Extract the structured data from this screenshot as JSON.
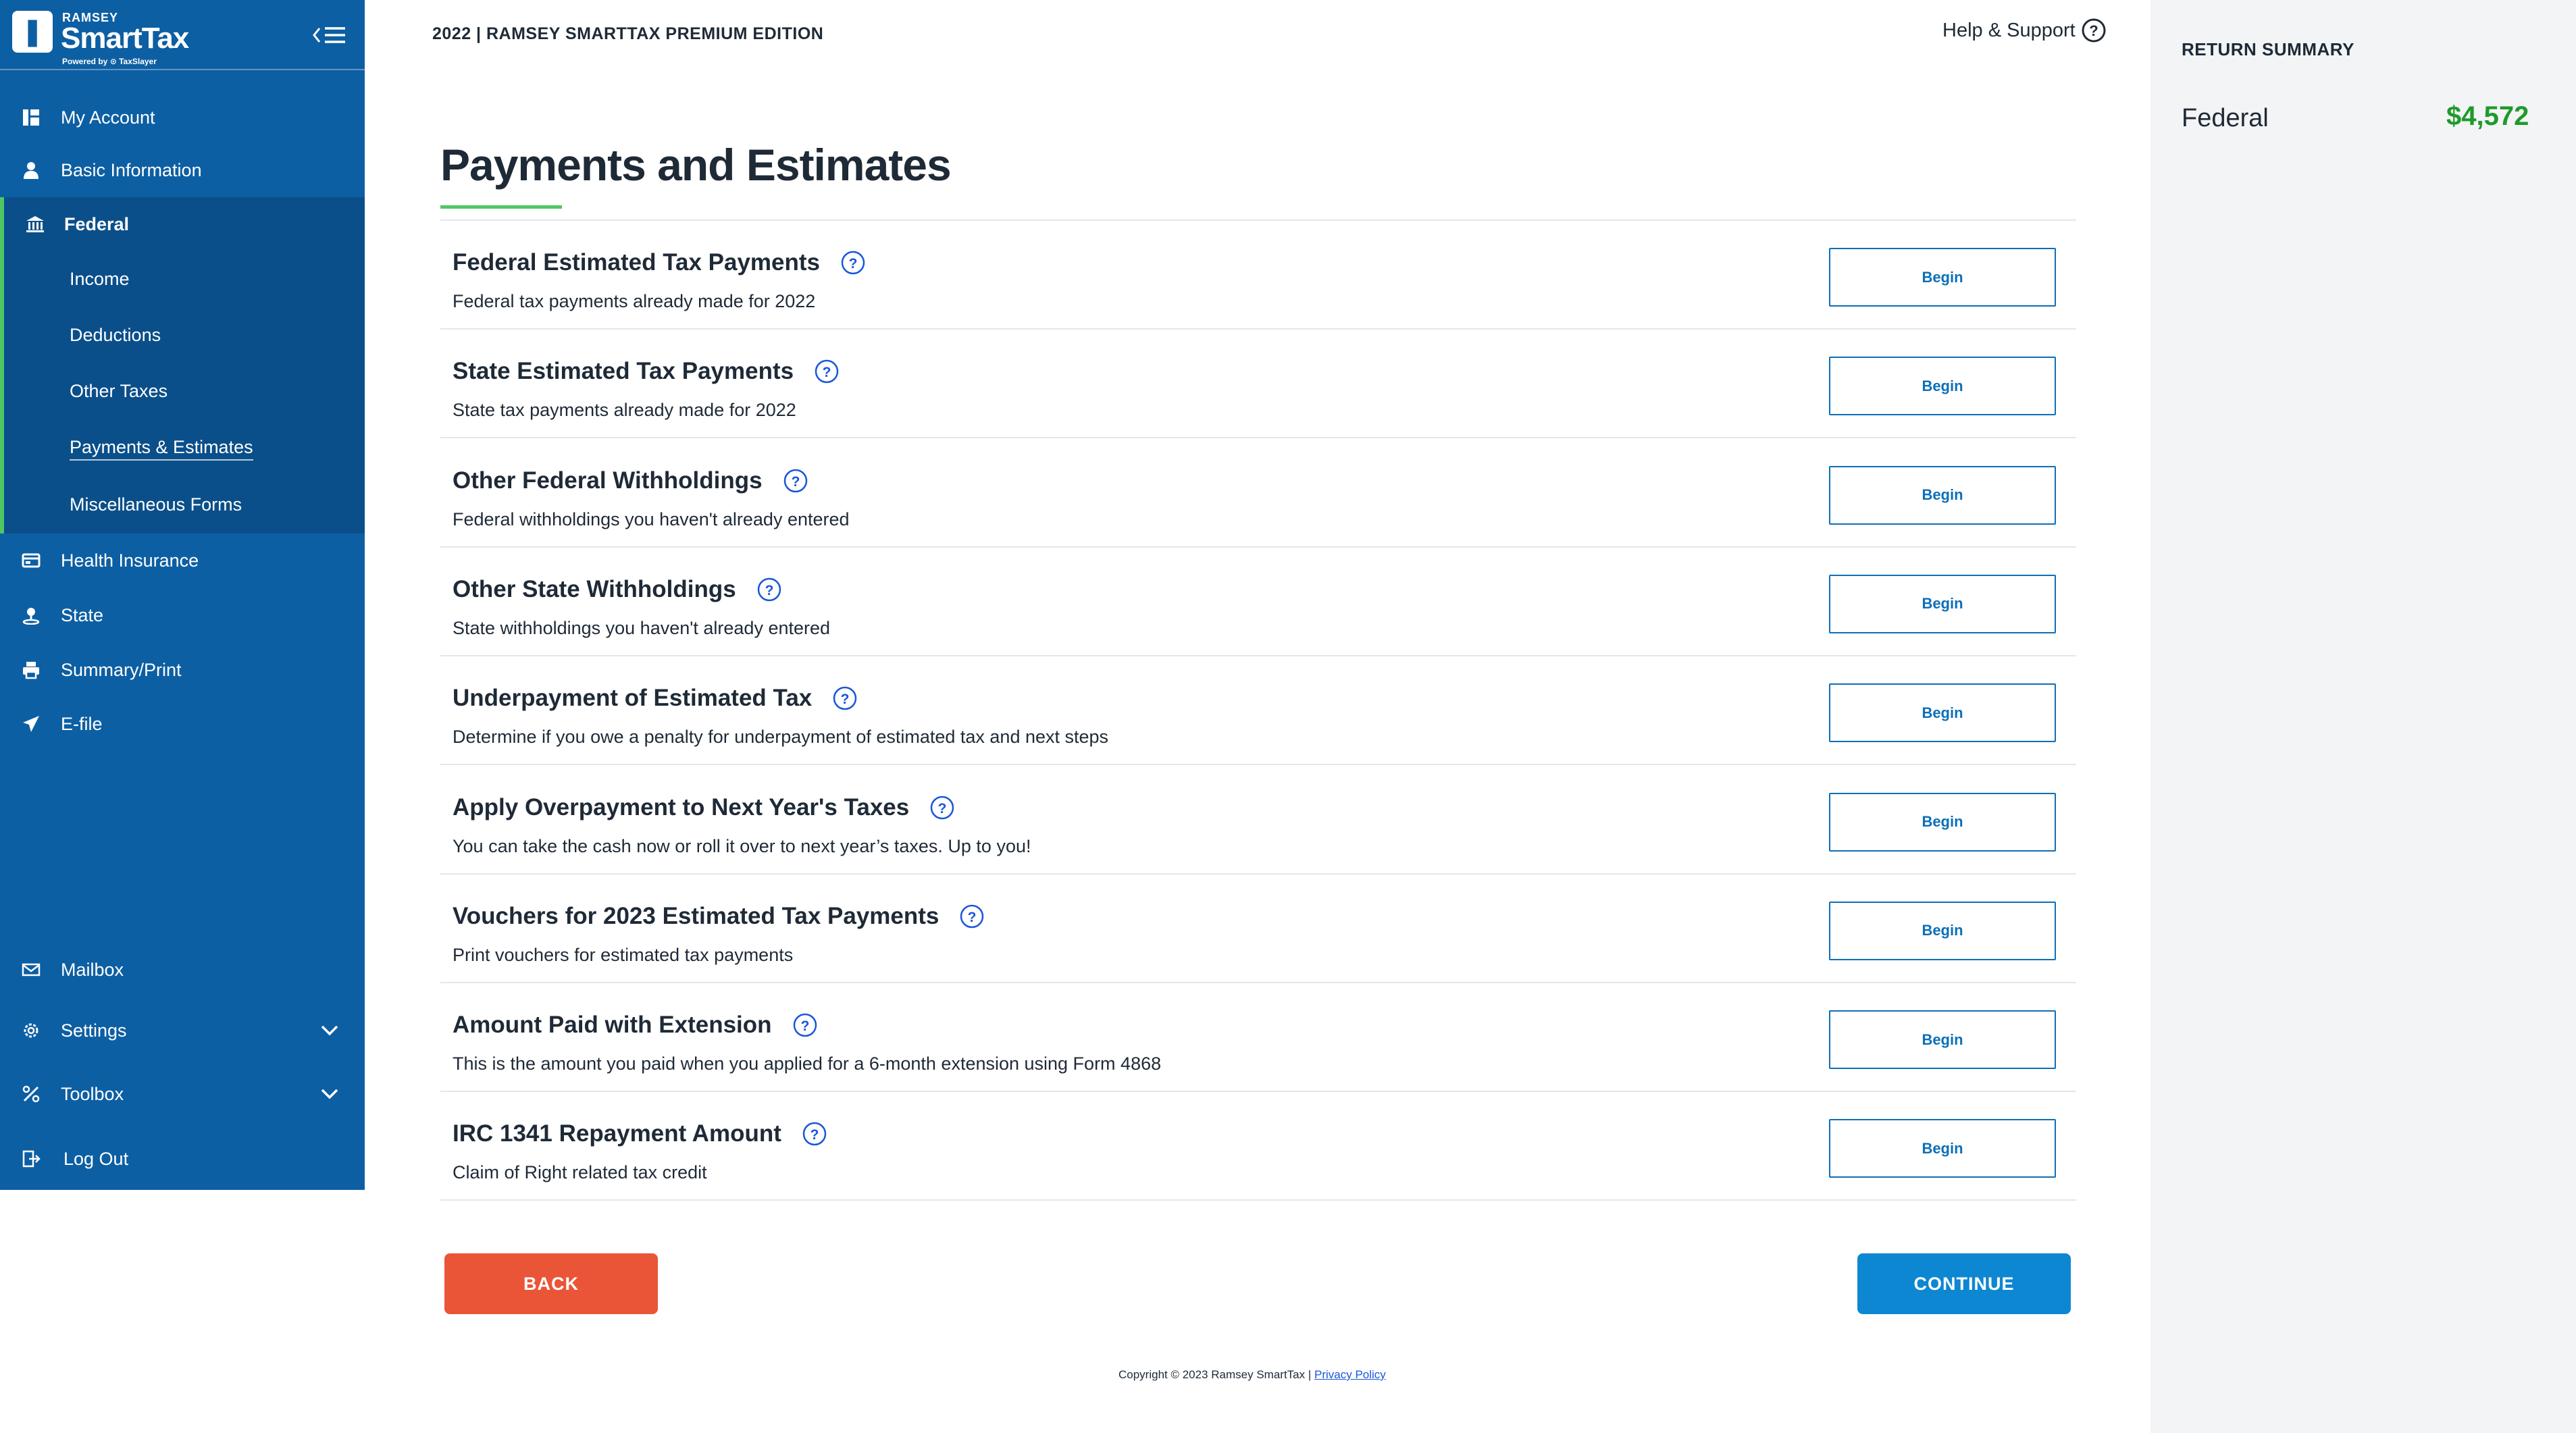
{
  "brand": {
    "small": "RAMSEY",
    "name": "SmartTax",
    "powered": "Powered by ⊙ TaxSlayer",
    "colors": {
      "primary": "#0d5fa3",
      "accent": "#4fc764"
    }
  },
  "sidebar": {
    "top_items": [
      {
        "label": "My Account",
        "icon": "dashboard-icon"
      },
      {
        "label": "Basic Information",
        "icon": "person-icon"
      },
      {
        "label": "Federal",
        "icon": "bank-icon"
      }
    ],
    "federal_subitems": [
      {
        "label": "Income"
      },
      {
        "label": "Deductions"
      },
      {
        "label": "Other Taxes"
      },
      {
        "label": "Payments & Estimates"
      },
      {
        "label": "Miscellaneous Forms"
      }
    ],
    "lower_items": [
      {
        "label": "Health Insurance",
        "icon": "card-icon"
      },
      {
        "label": "State",
        "icon": "pin-icon"
      },
      {
        "label": "Summary/Print",
        "icon": "printer-icon"
      },
      {
        "label": "E-file",
        "icon": "send-icon"
      }
    ],
    "bottom_items": [
      {
        "label": "Mailbox",
        "icon": "mail-icon"
      },
      {
        "label": "Settings",
        "icon": "gear-icon"
      },
      {
        "label": "Toolbox",
        "icon": "tools-icon"
      },
      {
        "label": "Log Out",
        "icon": "logout-icon"
      }
    ]
  },
  "header": {
    "edition": "2022 | RAMSEY SMARTTAX PREMIUM EDITION",
    "help_label": "Help & Support"
  },
  "main": {
    "title": "Payments and Estimates",
    "begin_label": "Begin",
    "rows": [
      {
        "title": "Federal Estimated Tax Payments",
        "desc": "Federal tax payments already made for 2022"
      },
      {
        "title": "State Estimated Tax Payments",
        "desc": "State tax payments already made for 2022"
      },
      {
        "title": "Other Federal Withholdings",
        "desc": "Federal withholdings you haven't already entered"
      },
      {
        "title": "Other State Withholdings",
        "desc": "State withholdings you haven't already entered"
      },
      {
        "title": "Underpayment of Estimated Tax",
        "desc": "Determine if you owe a penalty for underpayment of estimated tax and next steps"
      },
      {
        "title": "Apply Overpayment to Next Year's Taxes",
        "desc": "You can take the cash now or roll it over to next year’s taxes. Up to you!"
      },
      {
        "title": "Vouchers for 2023 Estimated Tax Payments",
        "desc": "Print vouchers for estimated tax payments"
      },
      {
        "title": "Amount Paid with Extension",
        "desc": "This is the amount you paid when you applied for a 6-month extension using Form 4868"
      },
      {
        "title": "IRC 1341 Repayment Amount",
        "desc": "Claim of Right related tax credit"
      }
    ],
    "back_label": "BACK",
    "continue_label": "CONTINUE"
  },
  "footer": {
    "copyright": "Copyright © 2023 Ramsey SmartTax | ",
    "privacy": "Privacy Policy"
  },
  "summary": {
    "title": "RETURN SUMMARY",
    "label": "Federal",
    "value": "$4,572",
    "value_color": "#1e9a2b"
  }
}
